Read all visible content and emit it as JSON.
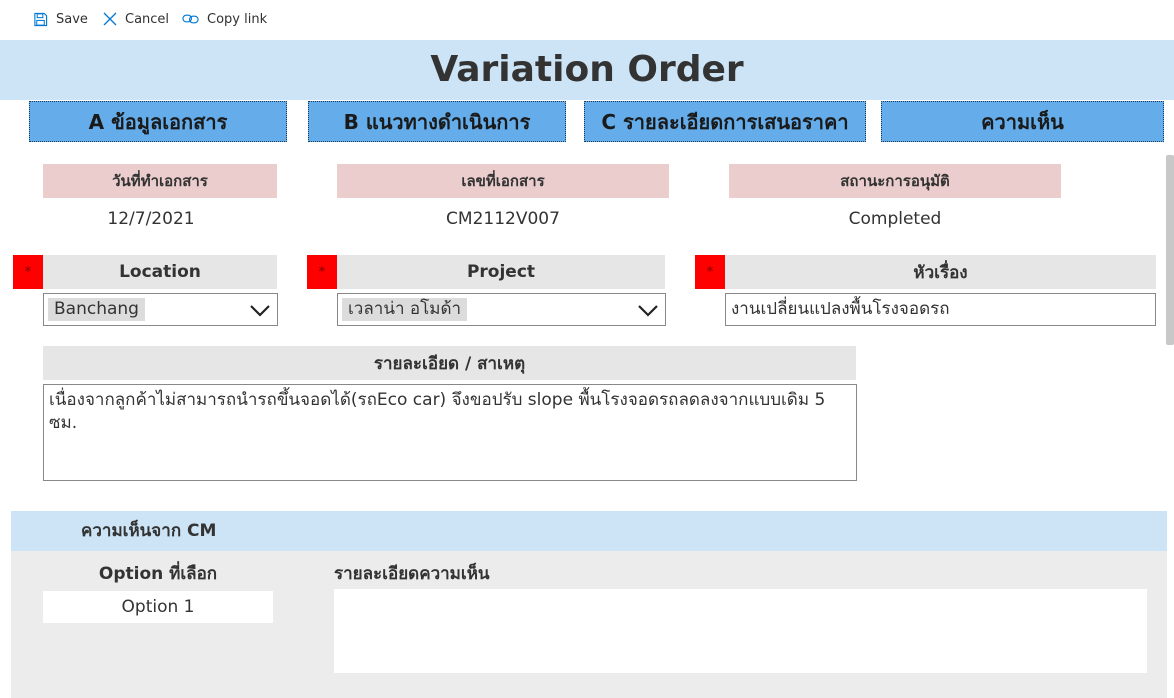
{
  "toolbar": {
    "save_label": "Save",
    "cancel_label": "Cancel",
    "copy_link_label": "Copy link"
  },
  "header": {
    "title": "Variation Order"
  },
  "tabs": [
    {
      "label": "A ข้อมูลเอกสาร"
    },
    {
      "label": "B แนวทางดำเนินการ"
    },
    {
      "label": "C รายละเอียดการเสนอราคา"
    },
    {
      "label": "ความเห็น"
    }
  ],
  "info": {
    "doc_date_label": "วันที่ทำเอกสาร",
    "doc_date_value": "12/7/2021",
    "doc_no_label": "เลขที่เอกสาร",
    "doc_no_value": "CM2112V007",
    "status_label": "สถานะการอนุมัติ",
    "status_value": "Completed"
  },
  "form": {
    "required_mark": "*",
    "location_label": "Location",
    "location_value": "Banchang",
    "project_label": "Project",
    "project_value": "เวลาน่า อโมด้า",
    "subject_label": "หัวเรื่อง",
    "subject_value": "งานเปลี่ยนแปลงพื้นโรงจอดรถ",
    "detail_label": "รายละเอียด / สาเหตุ",
    "detail_value": "เนื่องจากลูกค้าไม่สามารถนำรถขึ้นจอดได้(รถEco car) จึงขอปรับ slope พื้นโรงจอดรถลดลงจากแบบเดิม 5 ซม."
  },
  "cm_section": {
    "title": "ความเห็นจาก CM",
    "option_label": "Option ที่เลือก",
    "option_value": "Option 1",
    "comment_label": "รายละเอียดความเห็น",
    "comment_value": ""
  },
  "colors": {
    "title_band": "#cce4f6",
    "tab": "#64acea",
    "pink_label": "#eccdcd",
    "grey_label": "#e6e6e6",
    "required": "#ff0000"
  }
}
